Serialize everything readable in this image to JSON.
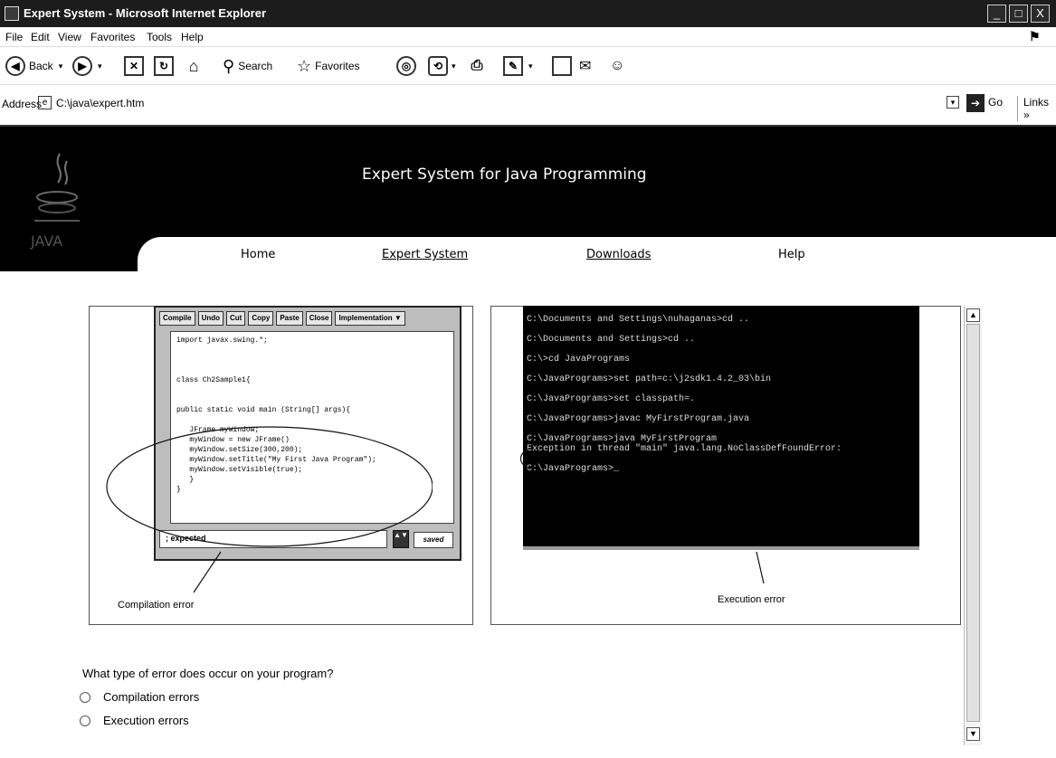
{
  "window": {
    "title": "Expert System - Microsoft Internet Explorer",
    "controls": [
      "_",
      "□",
      "X"
    ]
  },
  "menu": {
    "items": [
      "File",
      "Edit",
      "View",
      "Favorites",
      "Tools",
      "Help"
    ]
  },
  "toolbar": {
    "back_label": "Back",
    "search_label": "Search",
    "favorites_label": "Favorites"
  },
  "address": {
    "label": "Address",
    "value": "C:\\java\\expert.htm",
    "go_label": "Go",
    "links_label": "Links »"
  },
  "site": {
    "title": "Expert System for Java Programming",
    "nav": [
      "Home",
      "Expert System",
      "Downloads",
      "Help"
    ]
  },
  "ide": {
    "buttons": [
      "Compile",
      "Undo",
      "Cut",
      "Copy",
      "Paste",
      "Close",
      "Implementation ▼"
    ],
    "code": "import javax.swing.*;\n\n\n\nclass Ch2Sample1{\n\n\npublic static void main (String[] args){\n\n   JFrame myWindow;\n   myWindow = new JFrame()\n   myWindow.setSize(300,200);\n   myWindow.setTitle(\"My First Java Program\");\n   myWindow.setVisible(true);\n   }\n}",
    "status": "; expected",
    "saved": "saved"
  },
  "console": {
    "lines": [
      "C:\\Documents and Settings\\nuhaganas>cd ..",
      "C:\\Documents and Settings>cd ..",
      "C:\\>cd JavaPrograms",
      "C:\\JavaPrograms>set path=c:\\j2sdk1.4.2_03\\bin",
      "C:\\JavaPrograms>set classpath=.",
      "C:\\JavaPrograms>javac MyFirstProgram.java",
      "C:\\JavaPrograms>java MyFirstProgram",
      "Exception in thread \"main\" java.lang.NoClassDefFoundError:",
      "C:\\JavaPrograms>_"
    ]
  },
  "captions": {
    "compilation": "Compilation error",
    "execution": "Execution error"
  },
  "question": {
    "text": "What type of error does occur on your program?",
    "options": [
      "Compilation errors",
      "Execution errors"
    ]
  }
}
